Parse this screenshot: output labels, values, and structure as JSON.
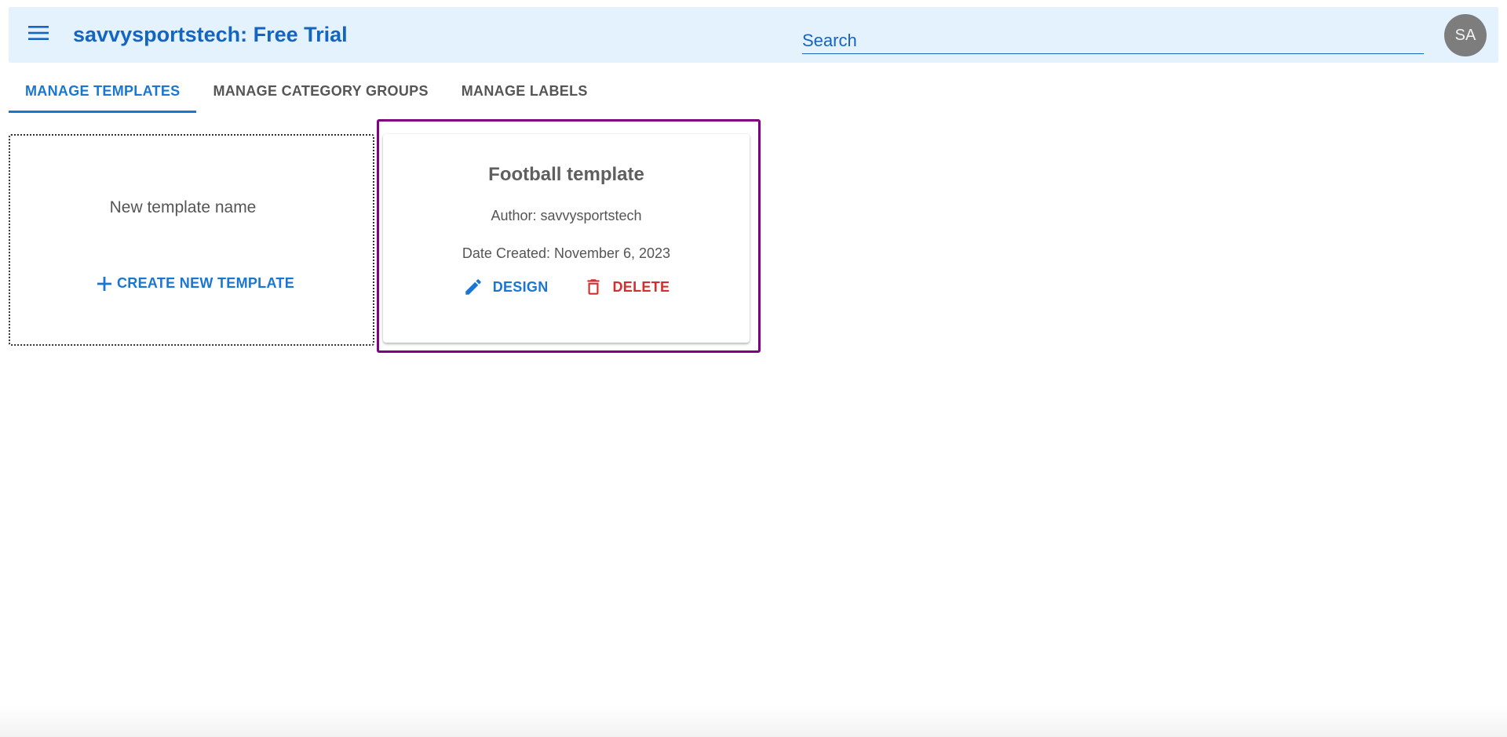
{
  "header": {
    "title": "savvysportstech: Free Trial",
    "search_placeholder": "Search",
    "avatar_initials": "SA"
  },
  "tabs": [
    {
      "label": "MANAGE TEMPLATES",
      "active": true
    },
    {
      "label": "MANAGE CATEGORY GROUPS",
      "active": false
    },
    {
      "label": "MANAGE LABELS",
      "active": false
    }
  ],
  "new_template": {
    "name_placeholder": "New template name",
    "create_label": "CREATE NEW TEMPLATE"
  },
  "templates": [
    {
      "title": "Football template",
      "author": "Author: savvysportstech",
      "date_created": "Date Created: November 6, 2023",
      "design_label": "DESIGN",
      "delete_label": "DELETE"
    }
  ],
  "colors": {
    "primary": "#1976d2",
    "appbar_bg": "#e3f2fd",
    "danger": "#d32f2f",
    "highlight": "#800080"
  }
}
